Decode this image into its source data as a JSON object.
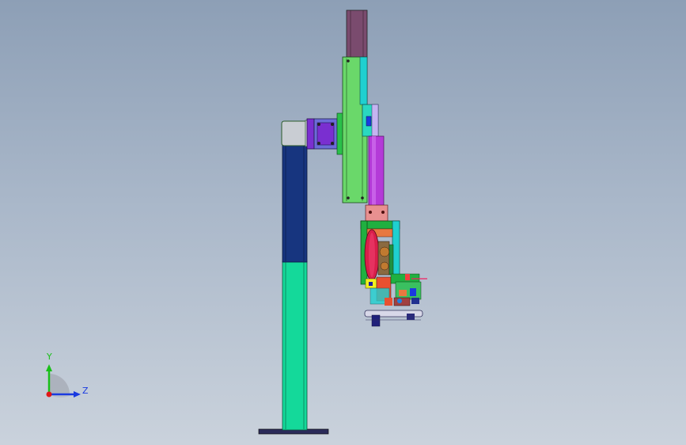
{
  "viewport": {
    "view": "side-view",
    "background_top": "#8d9fb6",
    "background_bottom": "#cad2dc"
  },
  "model": {
    "parts": [
      {
        "name": "column-base-plate",
        "color": "#2b2b5a"
      },
      {
        "name": "column-lower",
        "color": "#14d99a"
      },
      {
        "name": "column-upper",
        "color": "#17357f"
      },
      {
        "name": "column-cap",
        "color": "#c9cdd3"
      },
      {
        "name": "adapter-plate",
        "color": "#7a2fd0"
      },
      {
        "name": "mount-block",
        "color": "#6c6cd8"
      },
      {
        "name": "vertical-slide-motor",
        "color": "#7a4b6e"
      },
      {
        "name": "vertical-slide-rail",
        "color": "#6ad86a"
      },
      {
        "name": "slide-carriage",
        "color": "#1fd0d0"
      },
      {
        "name": "purple-shaft",
        "color": "#b43ad8"
      },
      {
        "name": "coupling",
        "color": "#e89090"
      },
      {
        "name": "tool-head",
        "color": "#1fb040"
      },
      {
        "name": "red-wheel",
        "color": "#d81e4a"
      }
    ]
  },
  "triad": {
    "y_label": "Y",
    "z_label": "Z",
    "y_color": "#19c019",
    "z_color": "#1a3ae0",
    "x_color": "#e01818"
  }
}
